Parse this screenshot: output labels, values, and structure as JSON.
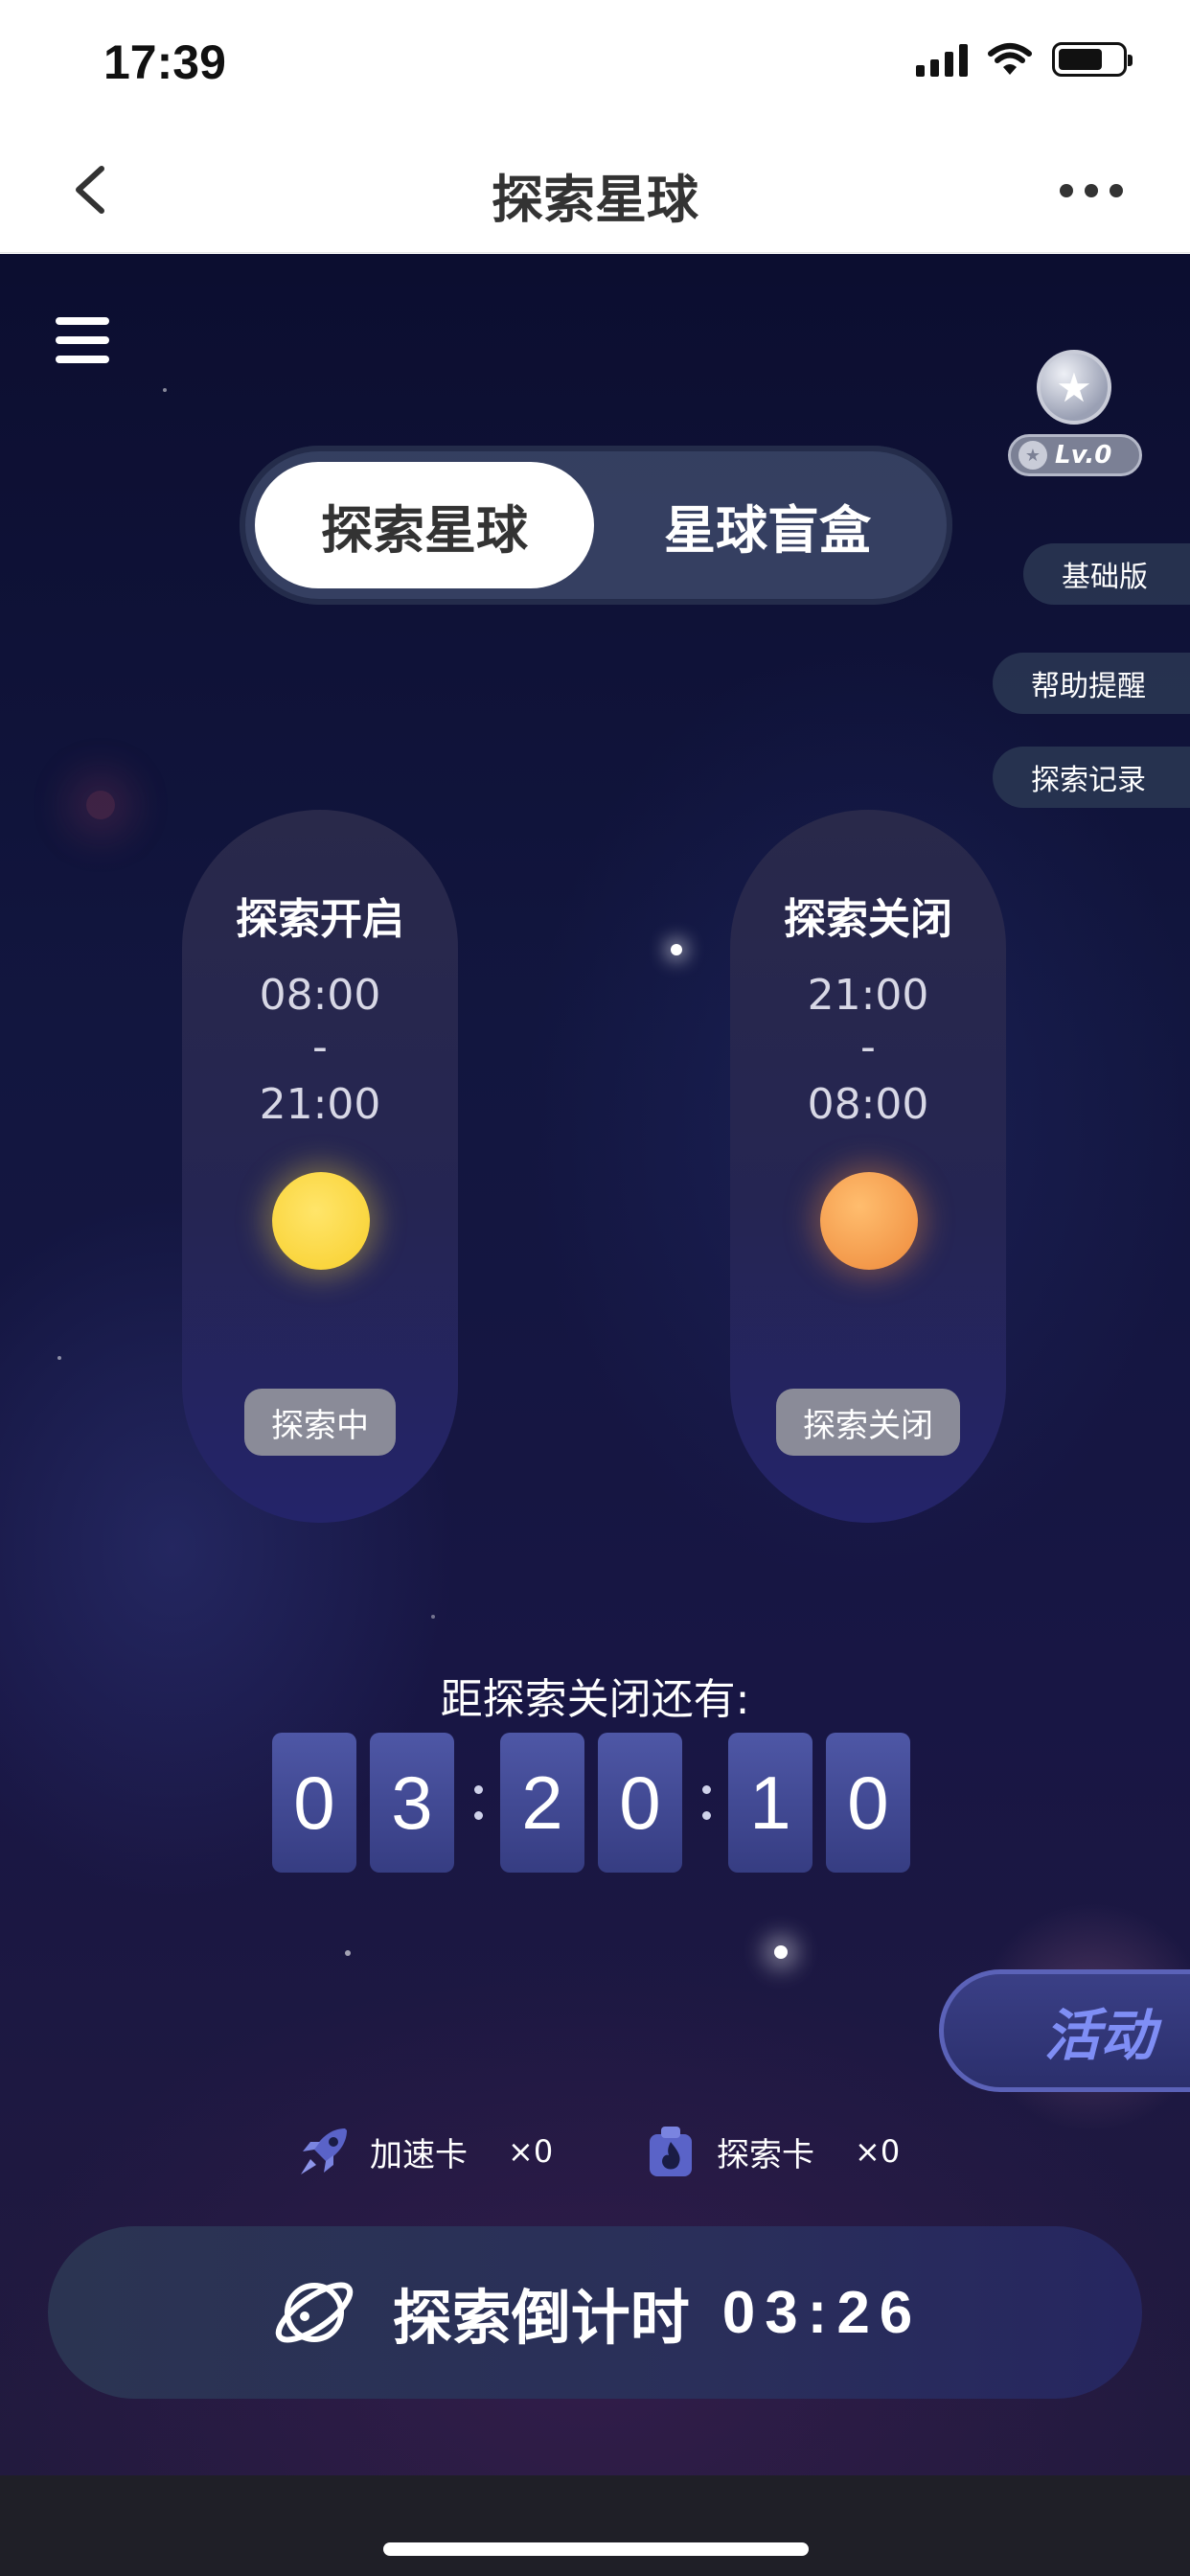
{
  "status_bar": {
    "time": "17:39",
    "signal_icon": "signal-icon",
    "wifi_icon": "wifi-icon",
    "battery_icon": "battery-icon"
  },
  "nav": {
    "title": "探索星球",
    "back_icon": "chevron-left-icon",
    "more_icon": "more-dots-icon"
  },
  "scene": {
    "menu_icon": "hamburger-menu-icon",
    "level": {
      "medal_icon": "star-medal-icon",
      "label": "Lv.0"
    },
    "side_buttons": [
      "基础版",
      "帮助提醒",
      "探索记录"
    ],
    "tabs": [
      {
        "label": "探索星球",
        "active": true
      },
      {
        "label": "星球盲盒",
        "active": false
      }
    ],
    "cards": [
      {
        "title": "探索开启",
        "start": "08:00",
        "sep": "-",
        "end": "21:00",
        "status": "探索中",
        "sun_color": "#f8d63a"
      },
      {
        "title": "探索关闭",
        "start": "21:00",
        "sep": "-",
        "end": "08:00",
        "status": "探索关闭",
        "sun_color": "#f0903f"
      }
    ],
    "countdown": {
      "label": "距探索关闭还有:",
      "digits": [
        "0",
        "3",
        "2",
        "0",
        "1",
        "0"
      ]
    },
    "activity_label": "活动",
    "inventory": [
      {
        "icon": "rocket-icon",
        "name": "加速卡",
        "count": "×0"
      },
      {
        "icon": "flame-bag-icon",
        "name": "探索卡",
        "count": "×0"
      }
    ],
    "main_button": {
      "icon": "planet-icon",
      "label": "探索倒计时",
      "time": "03:26"
    }
  },
  "colors": {
    "accent": "#7f8ef5",
    "background": "#12163f",
    "digit_tile": "#4e57a6"
  }
}
